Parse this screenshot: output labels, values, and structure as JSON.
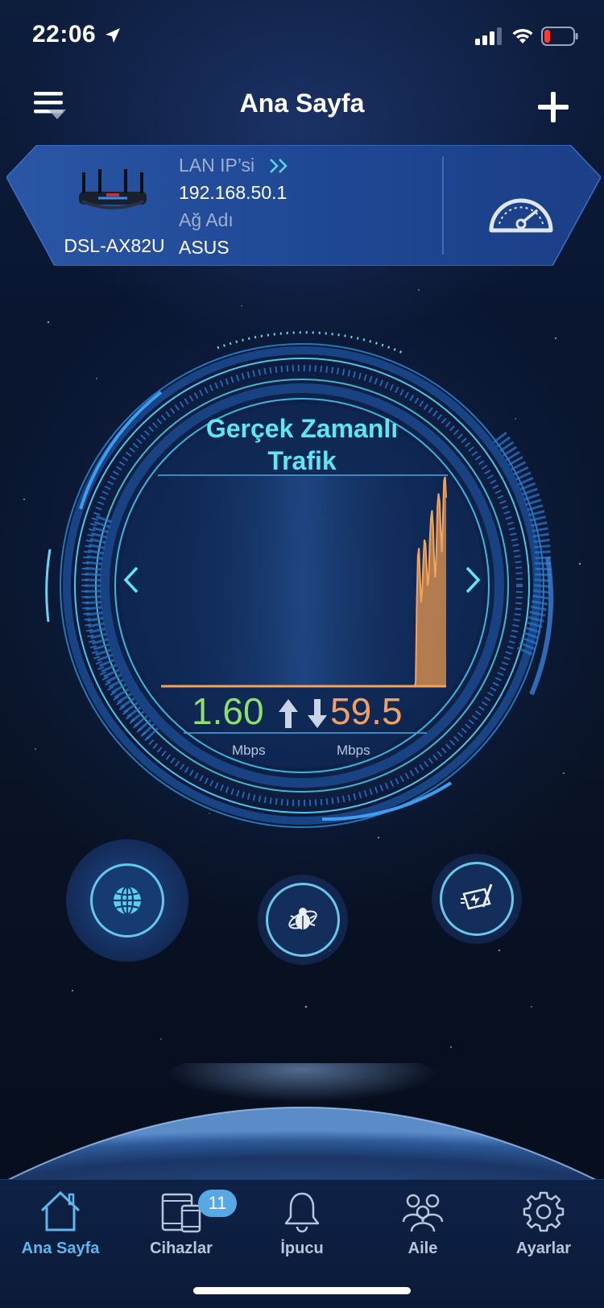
{
  "status_bar": {
    "time": "22:06"
  },
  "header": {
    "title": "Ana Sayfa"
  },
  "router": {
    "model": "DSL-AX82U",
    "lan_ip_label": "LAN IP’si",
    "lan_ip": "192.168.50.1",
    "network_name_label": "Ağ Adı",
    "network_name": "ASUS"
  },
  "traffic": {
    "title": "Gerçek Zamanlı Trafik",
    "upload_value": "1.60",
    "upload_unit": "Mbps",
    "download_value": "59.5",
    "download_unit": "Mbps"
  },
  "chart_data": {
    "type": "area",
    "series": [
      {
        "values": [
          0,
          0,
          0,
          0,
          0,
          0,
          0,
          0,
          0,
          0,
          0,
          0,
          0,
          0,
          0,
          0,
          0,
          0,
          0,
          0,
          0,
          0,
          0,
          0,
          0,
          0,
          0,
          0,
          0,
          0,
          0,
          0,
          0,
          0,
          0,
          0,
          0,
          0,
          0,
          0,
          0,
          0,
          0,
          0,
          0,
          0,
          0,
          0,
          0,
          0,
          0,
          0,
          0,
          0,
          0,
          0,
          0,
          0,
          0,
          0,
          0,
          0,
          0,
          0,
          0,
          0,
          0,
          0,
          0,
          0,
          0,
          0,
          0,
          0,
          0,
          0,
          0,
          0,
          0,
          0,
          0,
          0,
          0,
          0,
          0,
          0,
          0,
          0,
          0,
          0,
          0,
          0,
          0,
          0,
          0,
          0,
          0,
          0,
          0,
          0,
          0,
          0,
          0,
          0,
          0,
          0,
          0,
          0,
          0,
          0,
          0,
          0,
          0,
          0,
          0,
          0,
          0,
          0,
          0,
          0,
          0,
          0,
          0,
          0,
          0,
          0,
          0,
          0,
          0,
          0,
          0,
          0,
          0,
          0,
          0,
          0,
          0,
          0,
          0,
          0,
          0,
          0,
          0,
          0,
          0,
          0,
          0,
          0,
          0,
          0,
          0,
          0,
          0,
          0,
          0,
          0,
          0,
          0,
          0,
          0,
          0,
          0,
          0,
          0,
          0,
          0,
          0,
          0,
          0,
          0,
          0,
          0,
          0,
          0,
          0,
          0,
          0,
          0,
          0,
          0,
          0,
          0,
          0,
          0,
          0,
          0,
          0,
          0,
          0,
          0,
          0,
          0,
          0,
          0,
          0,
          0,
          0,
          0,
          0,
          0,
          0,
          0,
          0,
          0,
          0,
          0,
          0,
          0,
          0,
          0,
          0,
          0,
          0,
          0,
          0,
          0,
          0,
          0,
          0,
          0,
          0,
          0,
          0,
          0,
          0,
          0,
          0,
          0,
          0,
          0,
          0,
          0,
          0,
          0,
          2,
          40,
          62,
          66,
          52,
          40,
          46,
          60,
          70,
          68,
          58,
          48,
          52,
          70,
          80,
          84,
          76,
          60,
          52,
          64,
          86,
          92,
          88,
          74,
          64,
          80,
          98,
          100,
          90
        ]
      }
    ]
  },
  "quick_actions": {
    "internet_icon": "globe-icon",
    "aiprotection_icon": "shield-bug-icon",
    "boost_icon": "game-boost-icon"
  },
  "tabs": [
    {
      "label": "Ana Sayfa",
      "icon": "home-icon"
    },
    {
      "label": "Cihazlar",
      "icon": "devices-icon",
      "badge": "11"
    },
    {
      "label": "İpucu",
      "icon": "bell-icon"
    },
    {
      "label": "Aile",
      "icon": "family-icon"
    },
    {
      "label": "Ayarlar",
      "icon": "gear-icon"
    }
  ],
  "colors": {
    "accent": "#5fe6f2",
    "upload": "#8ee06a",
    "download": "#f0a062",
    "tab_active": "#5fb6ec"
  }
}
